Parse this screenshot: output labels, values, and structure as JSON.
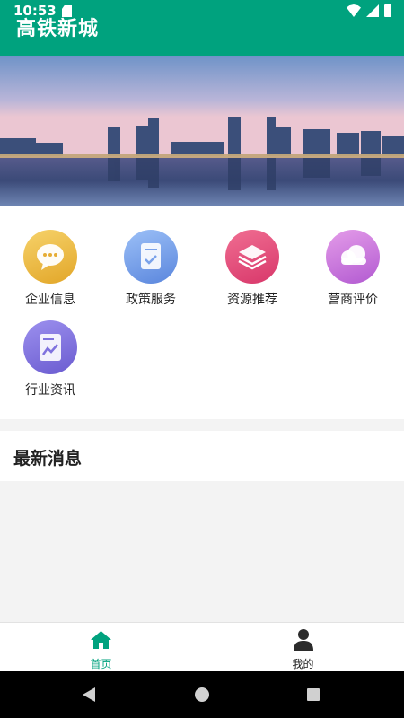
{
  "status_bar": {
    "time": "10:53"
  },
  "app_bar": {
    "title": "高铁新城"
  },
  "features": [
    {
      "label": "企业信息",
      "icon": "chat-bubble-icon",
      "color_from": "#f6d26a",
      "color_to": "#e2a628"
    },
    {
      "label": "政策服务",
      "icon": "document-check-icon",
      "color_from": "#9cc0f7",
      "color_to": "#5a86dd"
    },
    {
      "label": "资源推荐",
      "icon": "layers-icon",
      "color_from": "#f06e92",
      "color_to": "#d8376a"
    },
    {
      "label": "营商评价",
      "icon": "cloud-icon",
      "color_from": "#e49ce9",
      "color_to": "#b25ad1"
    },
    {
      "label": "行业资讯",
      "icon": "chart-document-icon",
      "color_from": "#9c90ee",
      "color_to": "#6a5bd0"
    }
  ],
  "news": {
    "title": "最新消息"
  },
  "bottom_nav": [
    {
      "label": "首页",
      "icon": "home-icon",
      "active": true
    },
    {
      "label": "我的",
      "icon": "person-icon",
      "active": false
    }
  ],
  "colors": {
    "primary": "#00a27e",
    "page_bg": "#f3f3f3"
  }
}
